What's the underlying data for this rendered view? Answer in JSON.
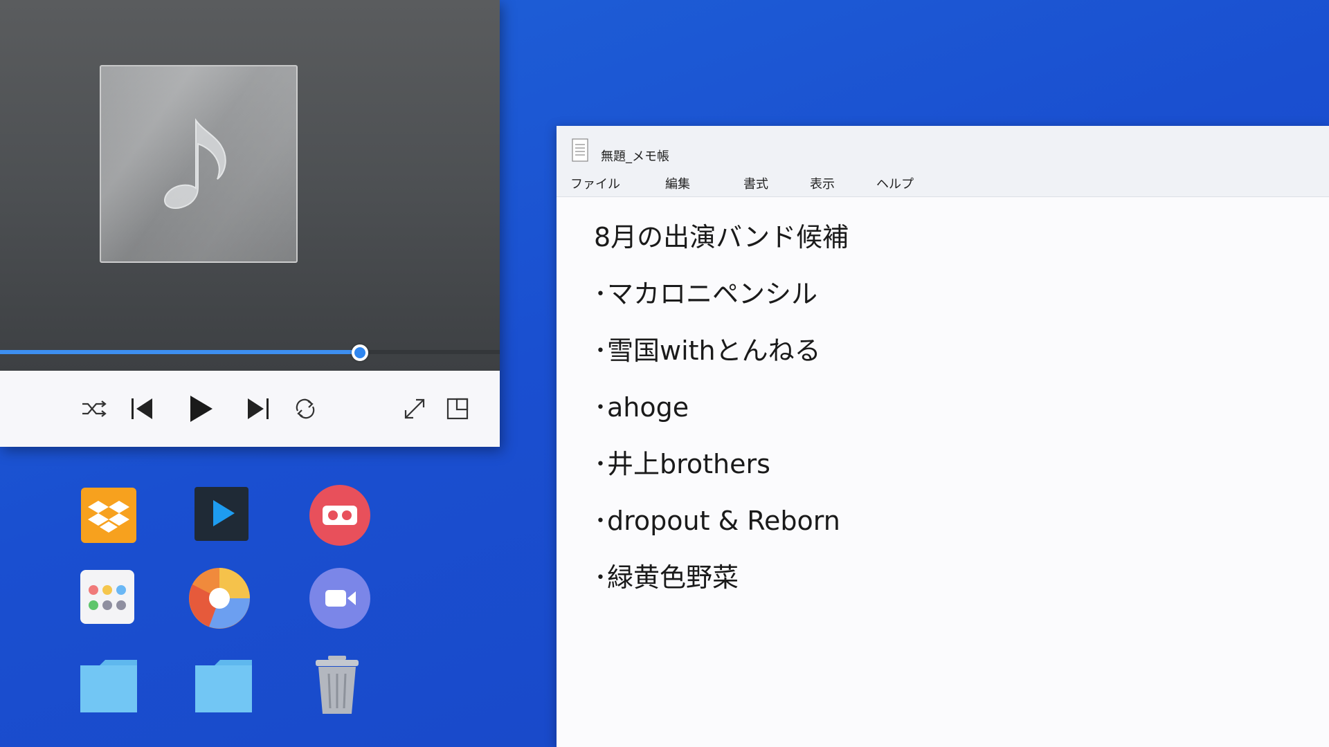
{
  "player": {
    "progress": 0.72,
    "controls": {
      "shuffle": "shuffle-icon",
      "previous": "skip-previous-icon",
      "play": "play-icon",
      "next": "skip-next-icon",
      "repeat": "repeat-icon",
      "expand": "expand-icon",
      "miniplayer": "miniplayer-icon"
    },
    "accent_color": "#3d8ff0"
  },
  "desktop_icons": [
    {
      "name": "dropbox-app-icon",
      "color": "#f7a11e"
    },
    {
      "name": "video-player-app-icon",
      "color": "#1f2a36"
    },
    {
      "name": "cassette-app-icon",
      "color": "#e8505b"
    },
    {
      "name": "launcher-app-icon",
      "color": "#f4f4f6"
    },
    {
      "name": "browser-app-icon",
      "color": "#f08a3c"
    },
    {
      "name": "video-call-app-icon",
      "color": "#7b86e8"
    },
    {
      "name": "folder-icon",
      "color": "#6fc4f2"
    },
    {
      "name": "folder-icon",
      "color": "#6fc4f2"
    },
    {
      "name": "trash-icon",
      "color": "#a9adb5"
    }
  ],
  "notepad": {
    "title": "無題_メモ帳",
    "menu": [
      "ファイル",
      "編集",
      "書式",
      "表示",
      "ヘルプ"
    ],
    "lines": [
      "8月の出演バンド候補",
      "･マカロニペンシル",
      "･雪国withとんねる",
      "･ahoge",
      "･井上brothers",
      "･dropout & Reborn",
      "･緑黄色野菜"
    ]
  },
  "desktop_background": "#1a4fd0"
}
